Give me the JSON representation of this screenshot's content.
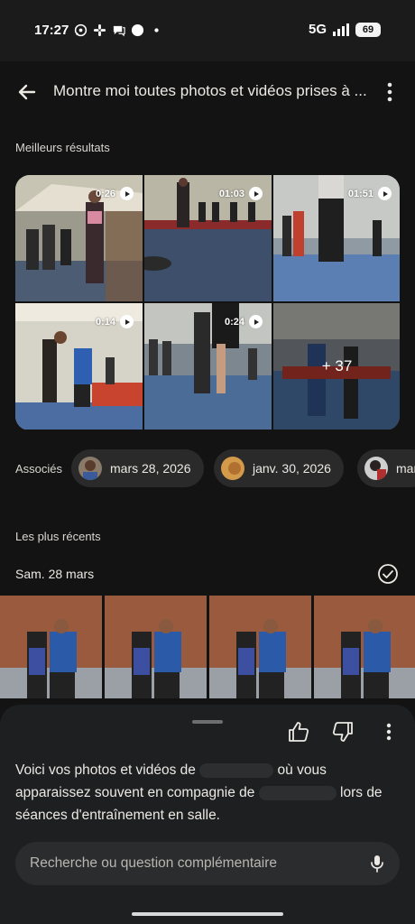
{
  "status_bar": {
    "time": "17:27",
    "network": "5G",
    "battery": "69",
    "left_icons": [
      "whatsapp-icon",
      "slack-icon",
      "chat-icon",
      "circle-icon",
      "dot-icon"
    ]
  },
  "app_bar": {
    "title": "Montre moi toutes photos et vidéos prises à ..."
  },
  "best_results": {
    "label": "Meilleurs résultats",
    "tiles": [
      {
        "duration": "0:26"
      },
      {
        "duration": "01:03"
      },
      {
        "duration": "01:51"
      },
      {
        "duration": "0:14"
      },
      {
        "duration": "0:24"
      },
      {
        "more": "+ 37"
      }
    ]
  },
  "associated": {
    "label": "Associés",
    "chips": [
      "mars 28, 2026",
      "janv. 30, 2026",
      "mar"
    ]
  },
  "recent": {
    "label": "Les plus récents",
    "date": "Sam. 28 mars"
  },
  "sheet": {
    "answer_part1": "Voici vos photos et vidéos de",
    "answer_part2": "où vous apparaissez souvent en compagnie de",
    "answer_part3": "lors de séances d'entraînement en salle.",
    "followup_placeholder": "Recherche ou question complémentaire"
  },
  "colors": {
    "background": "#131313",
    "sheet": "#1d1f21",
    "chip": "#2a2a2a",
    "text": "#ece9e4"
  }
}
